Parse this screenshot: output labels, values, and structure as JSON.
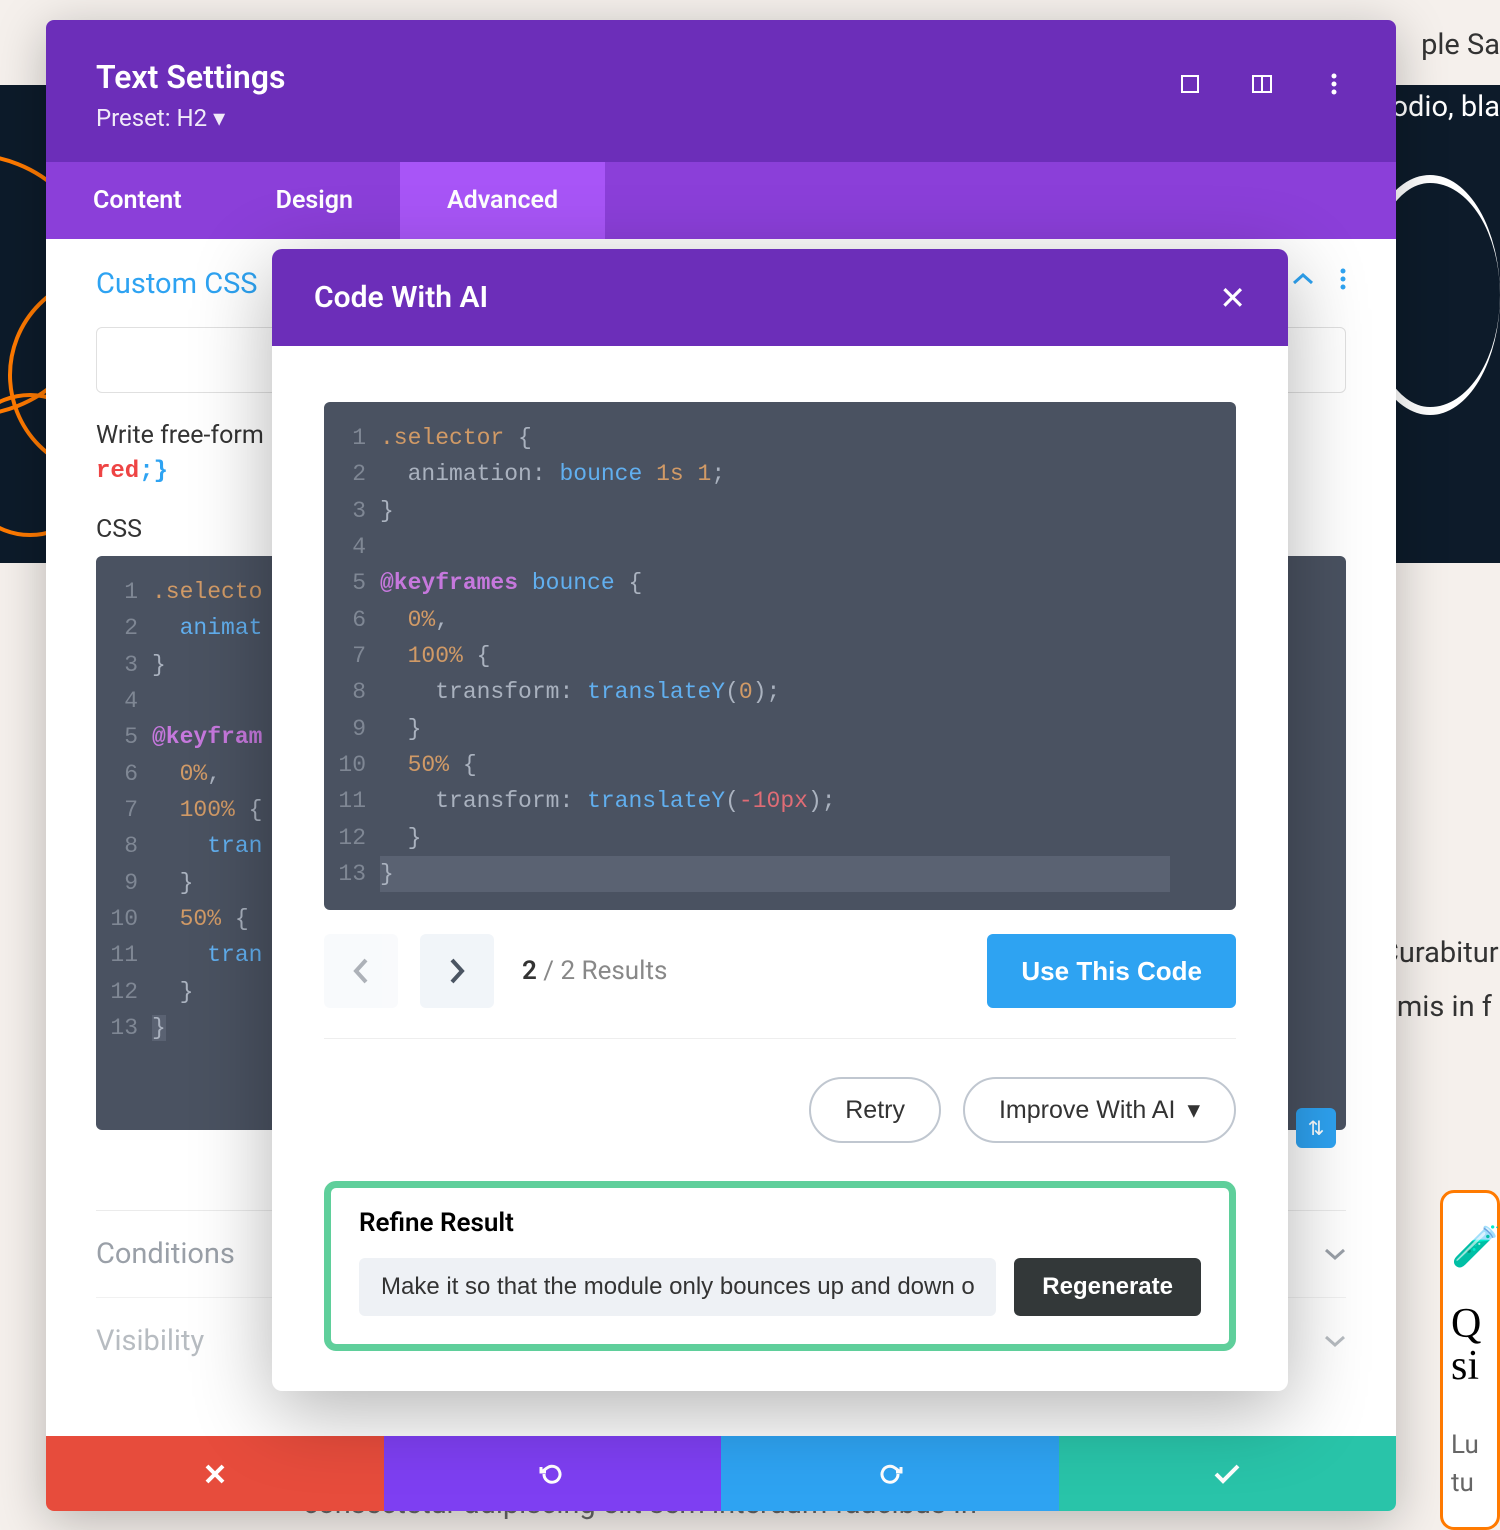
{
  "background": {
    "top_right_1": "ple    Sa",
    "top_right_2": "odio, bla",
    "mid_right_1": "Curabitur",
    "mid_right_2": "rimis in f",
    "card_q": "Q",
    "card_si": "si",
    "card_lu": "Lu",
    "card_tu": "tu",
    "bottom": "consectetur adipiscing elit         sem interdum faucibus  In"
  },
  "panel": {
    "title": "Text Settings",
    "preset_label": "Preset: H2",
    "tabs": {
      "content": "Content",
      "design": "Design",
      "advanced": "Advanced"
    },
    "section_title": "Custom CSS",
    "free_form": "Write free-form",
    "inline_code": {
      "prop": "red",
      "rest": ";}"
    },
    "css_label": "CSS",
    "accordion_conditions": "Conditions",
    "accordion_visibility": "Visibility"
  },
  "css_background": {
    "lines": [
      {
        "n": "1",
        "html": "<span class='tok-sel'>.selecto</span>"
      },
      {
        "n": "2",
        "html": "  <span class='tok-name'>animat</span>"
      },
      {
        "n": "3",
        "html": "<span class='tok-punc'>}</span>"
      },
      {
        "n": "4",
        "html": ""
      },
      {
        "n": "5",
        "html": "<span class='tok-kw'>@keyfram</span>"
      },
      {
        "n": "6",
        "html": "  <span class='tok-num'>0%</span><span class='tok-punc'>,</span>"
      },
      {
        "n": "7",
        "html": "  <span class='tok-num'>100%</span> <span class='tok-punc'>{</span>"
      },
      {
        "n": "8",
        "html": "    <span class='tok-name'>tran</span>"
      },
      {
        "n": "9",
        "html": "  <span class='tok-punc'>}</span>"
      },
      {
        "n": "10",
        "html": "  <span class='tok-num'>50%</span> <span class='tok-punc'>{</span>"
      },
      {
        "n": "11",
        "html": "    <span class='tok-name'>tran</span>"
      },
      {
        "n": "12",
        "html": "  <span class='tok-punc'>}</span>"
      },
      {
        "n": "13",
        "html": "<span class='tok-punc sel-hl'>}</span>"
      }
    ]
  },
  "ai": {
    "title": "Code With AI",
    "results_current": "2",
    "results_sep": " / ",
    "results_total": "2 Results",
    "use_code": "Use This Code",
    "retry": "Retry",
    "improve": "Improve With AI",
    "refine_title": "Refine Result",
    "refine_value": "Make it so that the module only bounces up and down one",
    "regenerate": "Regenerate",
    "code": {
      "lines": [
        {
          "n": "1",
          "html": "<span class='tok-sel'>.selector</span> <span class='tok-punc'>{</span>"
        },
        {
          "n": "2",
          "html": "  <span class='tok-prop'>animation</span><span class='tok-punc'>:</span> <span class='tok-name'>bounce</span> <span class='tok-num'>1s</span> <span class='tok-num'>1</span><span class='tok-punc'>;</span>"
        },
        {
          "n": "3",
          "html": "<span class='tok-punc'>}</span>"
        },
        {
          "n": "4",
          "html": ""
        },
        {
          "n": "5",
          "html": "<span class='tok-kw'>@keyframes</span> <span class='tok-name'>bounce</span> <span class='tok-punc'>{</span>"
        },
        {
          "n": "6",
          "html": "  <span class='tok-num'>0%</span><span class='tok-punc'>,</span>"
        },
        {
          "n": "7",
          "html": "  <span class='tok-num'>100%</span> <span class='tok-punc'>{</span>"
        },
        {
          "n": "8",
          "html": "    <span class='tok-prop'>transform</span><span class='tok-punc'>:</span> <span class='tok-fn'>translateY</span><span class='tok-punc'>(</span><span class='tok-num'>0</span><span class='tok-punc'>);</span>"
        },
        {
          "n": "9",
          "html": "  <span class='tok-punc'>}</span>"
        },
        {
          "n": "10",
          "html": "  <span class='tok-num'>50%</span> <span class='tok-punc'>{</span>"
        },
        {
          "n": "11",
          "html": "    <span class='tok-prop'>transform</span><span class='tok-punc'>:</span> <span class='tok-fn'>translateY</span><span class='tok-punc'>(</span><span class='tok-neg'>-10px</span><span class='tok-punc'>);</span>"
        },
        {
          "n": "12",
          "html": "  <span class='tok-punc'>}</span>"
        },
        {
          "n": "13",
          "html": "<span class='tok-punc sel-hl' style='display:inline-block;width:790px'>}</span>"
        }
      ]
    }
  }
}
